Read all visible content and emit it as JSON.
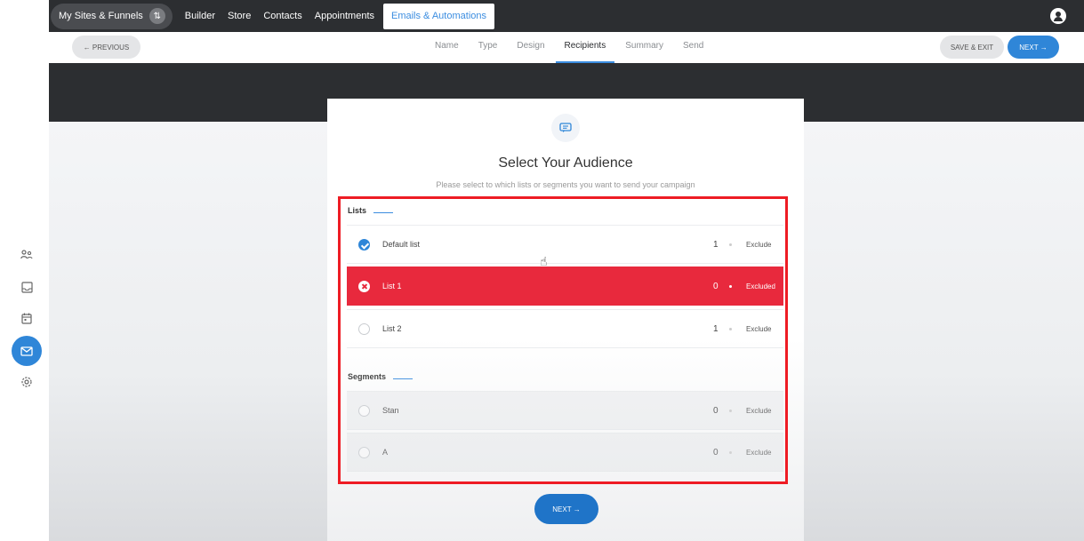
{
  "topnav": {
    "site_switcher": "My Sites & Funnels",
    "items": [
      "Builder",
      "Store",
      "Contacts",
      "Appointments"
    ],
    "active_item": "Emails & Automations"
  },
  "stepbar": {
    "previous_label": "← PREVIOUS",
    "steps": [
      "Name",
      "Type",
      "Design",
      "Recipients",
      "Summary",
      "Send"
    ],
    "active_step": "Recipients",
    "save_exit_label": "SAVE & EXIT",
    "next_label": "NEXT →"
  },
  "card": {
    "title": "Select Your Audience",
    "subtitle": "Please select to which lists or segments you want to send your campaign",
    "lists_label": "Lists",
    "lists": [
      {
        "name": "Default list",
        "count": "1",
        "action": "Exclude",
        "state": "selected"
      },
      {
        "name": "List 1",
        "count": "0",
        "action": "Excluded",
        "state": "excluded"
      },
      {
        "name": "List 2",
        "count": "1",
        "action": "Exclude",
        "state": "none"
      }
    ],
    "segments_label": "Segments",
    "segments": [
      {
        "name": "Stan",
        "count": "0",
        "action": "Exclude",
        "state": "none"
      },
      {
        "name": "A",
        "count": "0",
        "action": "Exclude",
        "state": "none"
      }
    ],
    "next_label": "NEXT →"
  },
  "colors": {
    "accent": "#2f86d8",
    "excluded": "#e8293d",
    "highlight": "#ee1c24",
    "dark": "#2c2e31"
  },
  "icons": {
    "sidebar": [
      "contacts-icon",
      "inbox-icon",
      "calendar-icon",
      "email-icon",
      "settings-icon"
    ],
    "card": "message-icon"
  }
}
